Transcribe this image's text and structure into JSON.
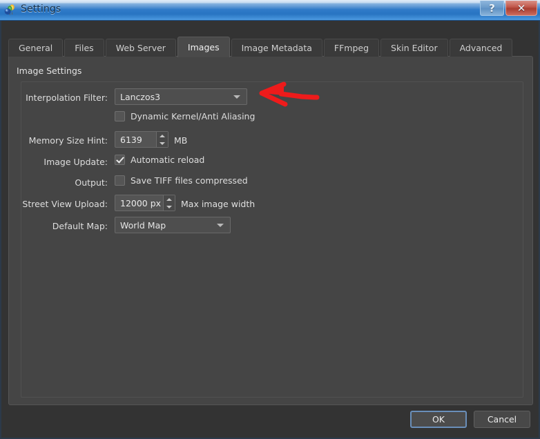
{
  "window": {
    "title": "Settings",
    "icon": "app-balloons-icon",
    "help_button": "?",
    "close_button": "✕",
    "accent_titlebar": "#2f7ac8",
    "close_button_color": "#b8483a"
  },
  "tabs": [
    {
      "label": "General",
      "active": false
    },
    {
      "label": "Files",
      "active": false
    },
    {
      "label": "Web Server",
      "active": false
    },
    {
      "label": "Images",
      "active": true
    },
    {
      "label": "Image Metadata",
      "active": false
    },
    {
      "label": "FFmpeg",
      "active": false
    },
    {
      "label": "Skin Editor",
      "active": false
    },
    {
      "label": "Advanced",
      "active": false
    }
  ],
  "group": {
    "title": "Image Settings"
  },
  "fields": {
    "interpolation_filter": {
      "label": "Interpolation Filter:",
      "value": "Lanczos3",
      "caret_icon": "chevron-down-icon"
    },
    "dynamic_kernel": {
      "label": "Dynamic Kernel/Anti Aliasing",
      "checked": false
    },
    "memory_size_hint": {
      "label": "Memory Size Hint:",
      "value": "6139",
      "unit": "MB",
      "up_icon": "spinner-up-icon",
      "down_icon": "spinner-down-icon"
    },
    "image_update": {
      "label": "Image Update:",
      "checkbox_label": "Automatic reload",
      "checked": true
    },
    "output": {
      "label": "Output:",
      "checkbox_label": "Save TIFF files compressed",
      "checked": false
    },
    "street_view_upload": {
      "label": "Street View Upload:",
      "value": "12000 px",
      "unit": "Max image width"
    },
    "default_map": {
      "label": "Default Map:",
      "value": "World Map",
      "caret_icon": "chevron-down-icon"
    }
  },
  "annotation": {
    "type": "red-left-arrow",
    "color": "#ee1b1b",
    "points_at": "interpolation-filter-combo"
  },
  "footer": {
    "ok_label": "OK",
    "cancel_label": "Cancel"
  }
}
